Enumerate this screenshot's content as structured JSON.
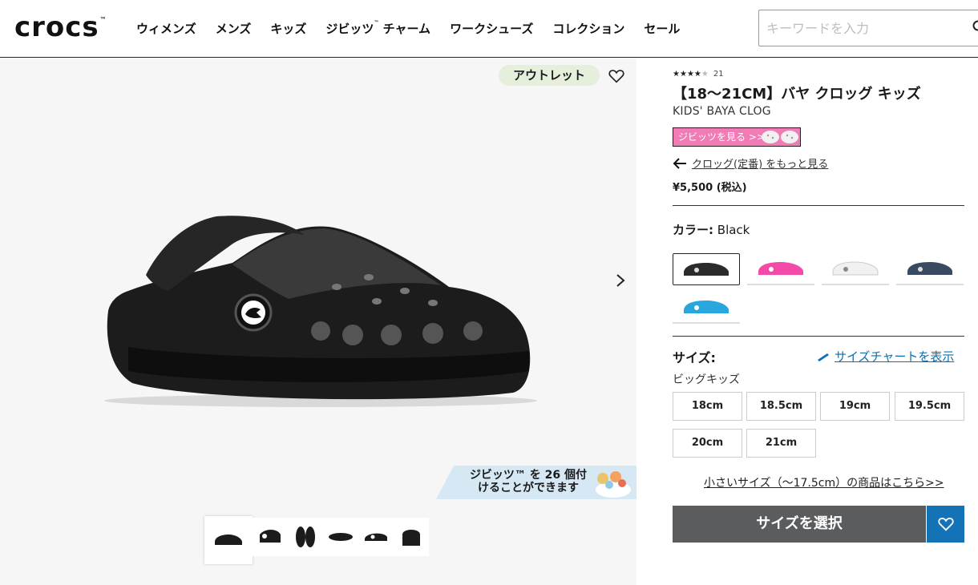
{
  "header": {
    "logo": "crocs",
    "logo_tm": "™",
    "nav": [
      {
        "label": "ウィメンズ"
      },
      {
        "label": "メンズ"
      },
      {
        "label": "キッズ"
      },
      {
        "label": "ジビッツ"
      },
      {
        "label": "ワークシューズ"
      },
      {
        "label": "コレクション"
      },
      {
        "label": "セール"
      }
    ],
    "nav_jibbitz_tm": "™",
    "nav_jibbitz_suffix": " チャーム",
    "search_placeholder": "キーワードを入力"
  },
  "gallery": {
    "badge": "アウトレット",
    "jibbitz_banner_line1": "ジビッツ™ を 26 個付",
    "jibbitz_banner_line2": "けることができます",
    "thumbnail_count": 6
  },
  "product": {
    "rating": 4,
    "rating_max": 5,
    "review_count": "21",
    "title": "【18～21CM】バヤ クロッグ キッズ",
    "subtitle": "KIDS' BAYA CLOG",
    "jibbitz_button": "ジビッツを見る >>",
    "back_link": "クロッグ(定番) をもっと見る",
    "price": "¥5,500 (税込)",
    "color_label": "カラー:",
    "color_value": "Black",
    "colors": [
      {
        "name": "Black",
        "hex": "#2b2b2b"
      },
      {
        "name": "Pink",
        "hex": "#f24aa6"
      },
      {
        "name": "White",
        "hex": "#f1f1f1"
      },
      {
        "name": "Navy",
        "hex": "#3b4a63"
      },
      {
        "name": "Blue",
        "hex": "#2aa6df"
      }
    ],
    "size_label": "サイズ:",
    "size_chart_link": "サイズチャートを表示",
    "size_group": "ビッグキッズ",
    "sizes": [
      "18cm",
      "18.5cm",
      "19cm",
      "19.5cm",
      "20cm",
      "21cm"
    ],
    "small_sizes_link": "小さいサイズ（～17.5cm）の商品はこちら>>",
    "select_button": "サイズを選択"
  }
}
